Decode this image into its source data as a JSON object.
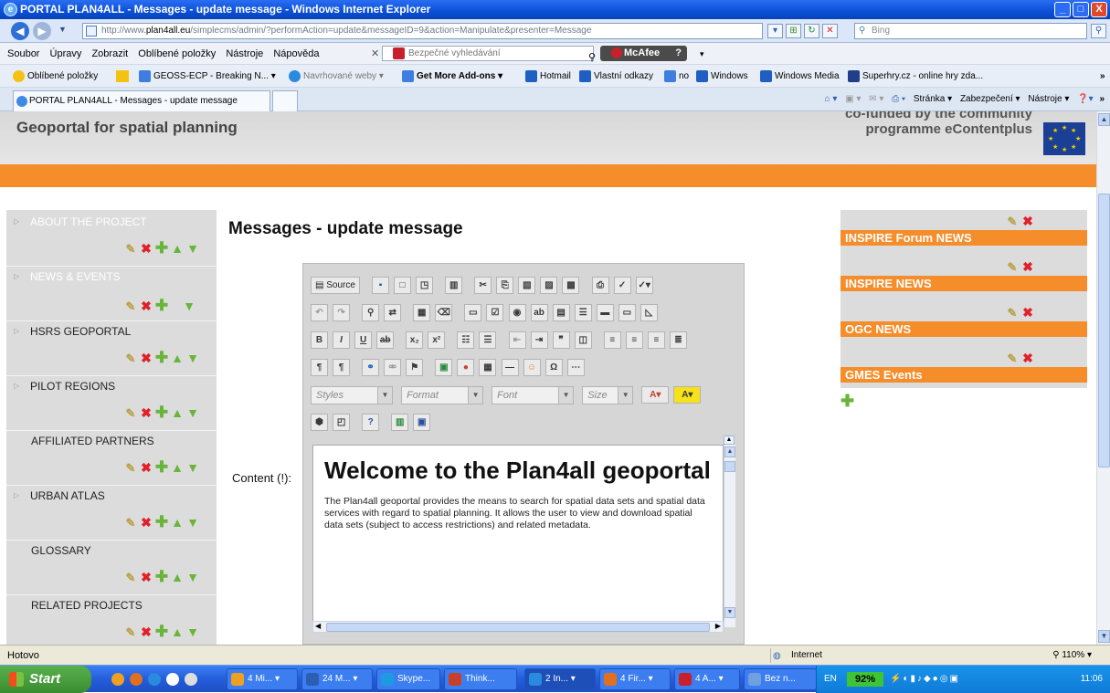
{
  "window": {
    "title": "PORTAL PLAN4ALL - Messages - update message - Windows Internet Explorer",
    "buttons": [
      "_",
      "□",
      "X"
    ]
  },
  "address": {
    "url_prefix": "http://www.",
    "url_domain": "plan4all.eu",
    "url_rest": "/simplecms/admin/?performAction=update&messageID=9&action=Manipulate&presenter=Message",
    "search_placeholder": "Bing"
  },
  "menu": {
    "items": [
      "Soubor",
      "Úpravy",
      "Zobrazit",
      "Oblíbené položky",
      "Nástroje",
      "Nápověda"
    ],
    "safe_search": "Bezpečné vyhledávání",
    "mcafee": "McAfee"
  },
  "favorites": {
    "label": "Oblíbené položky",
    "items": [
      "GEOSS-ECP - Breaking N...",
      "Navrhované weby",
      "Get More Add-ons",
      "Hotmail",
      "Vlastní odkazy",
      "no",
      "Windows",
      "Windows Media",
      "Superhry.cz - online hry zda..."
    ]
  },
  "tab": {
    "title": "PORTAL PLAN4ALL - Messages - update message",
    "commands": [
      "Stránka",
      "Zabezpečení",
      "Nástroje"
    ]
  },
  "site": {
    "title": "Geoportal for spatial planning",
    "cofund_line1": "co-funded by the community",
    "cofund_line2": "programme eContentplus"
  },
  "sidebar": {
    "items": [
      {
        "label": "ABOUT THE PROJECT"
      },
      {
        "label": "NEWS & EVENTS"
      },
      {
        "label": "HSRS GEOPORTAL"
      },
      {
        "label": "PILOT REGIONS"
      },
      {
        "label": "AFFILIATED PARTNERS"
      },
      {
        "label": "URBAN ATLAS"
      },
      {
        "label": "GLOSSARY"
      },
      {
        "label": "RELATED PROJECTS"
      }
    ]
  },
  "main": {
    "page_title": "Messages - update message",
    "content_label": "Content (!):"
  },
  "editor": {
    "source_label": "Source",
    "styles": "Styles",
    "format": "Format",
    "font": "Font",
    "size": "Size",
    "heading": "Welcome to the Plan4all geoportal",
    "paragraph": "The Plan4all geoportal provides the means to search for spatial data sets and spatial data services with regard to spatial planning. It allows the user to view and download spatial data sets (subject to access restrictions) and related metadata."
  },
  "news": {
    "items": [
      "INSPIRE Forum NEWS",
      "INSPIRE NEWS",
      "OGC NEWS",
      "GMES Events"
    ]
  },
  "status": {
    "left": "Hotovo",
    "zone": "Internet",
    "zoom": "110%"
  },
  "taskbar": {
    "start": "Start",
    "tasks": [
      "4 Mi...",
      "24 M...",
      "Skype...",
      "Think...",
      "2 In...",
      "4 Fir...",
      "4 A...",
      "Bez n..."
    ],
    "lang": "EN",
    "battery": "92%",
    "clock": "11:06"
  },
  "colors": {
    "accent_orange": "#f58d2a",
    "xp_blue": "#245ddb",
    "delete_red": "#e0202a",
    "add_green": "#69b43a"
  }
}
